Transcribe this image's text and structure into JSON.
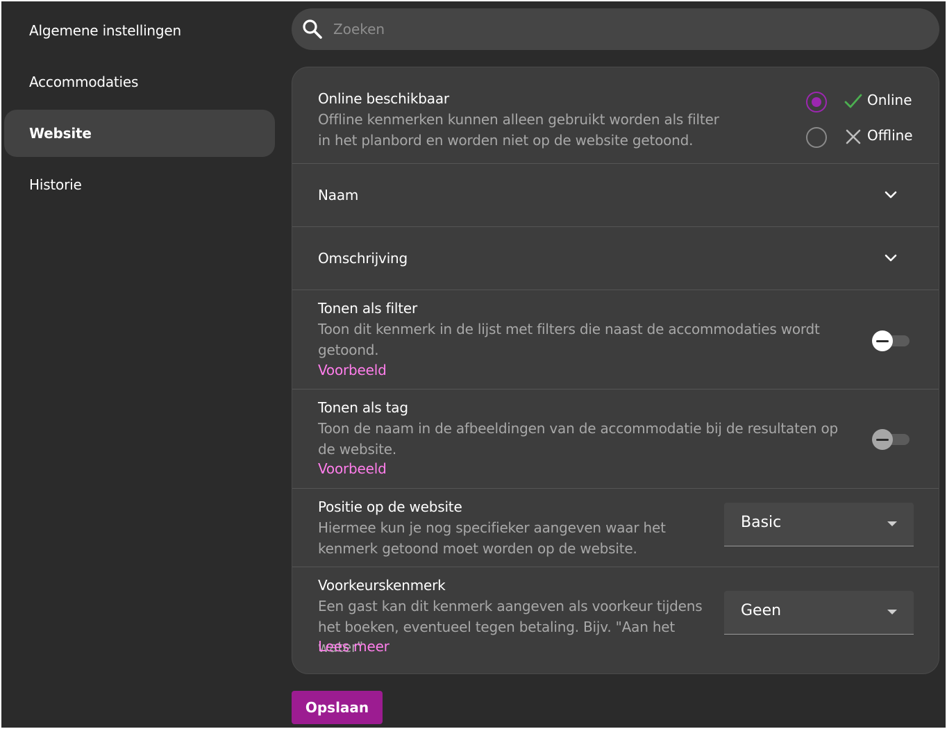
{
  "sidebar": {
    "items": [
      {
        "label": "Algemene instellingen",
        "active": false
      },
      {
        "label": "Accommodaties",
        "active": false
      },
      {
        "label": "Website",
        "active": true
      },
      {
        "label": "Historie",
        "active": false
      }
    ]
  },
  "search": {
    "placeholder": "Zoeken",
    "icon": "search-icon"
  },
  "online": {
    "title": "Online beschikbaar",
    "description": "Offline kenmerken kunnen alleen gebruikt worden als filter in het planbord en worden niet op de website getoond.",
    "options": [
      {
        "label": "Online",
        "icon": "check-icon",
        "selected": true
      },
      {
        "label": "Offline",
        "icon": "x-icon",
        "selected": false
      }
    ]
  },
  "naam": {
    "title": "Naam",
    "icon": "chevron-down-icon"
  },
  "omschrijving": {
    "title": "Omschrijving",
    "icon": "chevron-down-icon"
  },
  "filter": {
    "title": "Tonen als filter",
    "description": "Toon dit kenmerk in de lijst met filters die naast de accommodaties wordt getoond.",
    "link": "Voorbeeld",
    "enabled": false
  },
  "tag": {
    "title": "Tonen als tag",
    "description": "Toon de naam in de afbeeldingen van de accommodatie bij de resultaten op de website.",
    "link": "Voorbeeld",
    "enabled": false
  },
  "positie": {
    "title": "Positie op de website",
    "description": "Hiermee kun je nog specifieker aangeven waar het kenmerk getoond moet worden op de website.",
    "selected": "Basic"
  },
  "voorkeur": {
    "title": "Voorkeurskenmerk",
    "description": "Een gast kan dit kenmerk aangeven als voorkeur tijdens het boeken, eventueel tegen betaling. Bijv. \"Aan het water\"",
    "link": "Lees meer",
    "selected": "Geen"
  },
  "save_label": "Opslaan",
  "colors": {
    "accent": "#9c27b0",
    "button": "#9c1c91",
    "link": "#ff7eeb",
    "check": "#4caf50"
  }
}
